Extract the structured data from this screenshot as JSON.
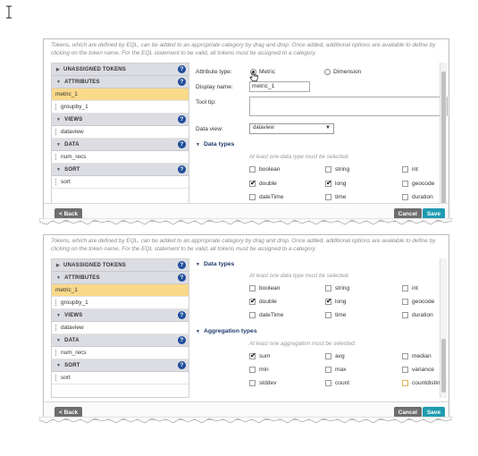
{
  "intro": "Tokens, which are defined by EQL, can be added to an appropriate category by drag and drop. Once added, additional options are available to define by clicking on the token name. For the EQL statement to be valid, all tokens must be assigned to a category.",
  "sidebar": {
    "sections": [
      {
        "title": "UNASSIGNED TOKENS",
        "items": []
      },
      {
        "title": "ATTRIBUTES",
        "items": [
          {
            "label": "metric_1",
            "selected": true
          },
          {
            "label": "groupby_1",
            "selected": false
          }
        ]
      },
      {
        "title": "VIEWS",
        "items": [
          {
            "label": "dataview",
            "selected": false
          }
        ]
      },
      {
        "title": "DATA",
        "items": [
          {
            "label": "num_recs",
            "selected": false
          }
        ]
      },
      {
        "title": "SORT",
        "items": [
          {
            "label": "sort",
            "selected": false
          }
        ]
      }
    ]
  },
  "form": {
    "attribute_type_label": "Attribute type:",
    "metric_label": "Metric",
    "dimension_label": "Dimension",
    "display_name_label": "Display name:",
    "display_name_value": "metric_1",
    "tooltip_label": "Tool tip:",
    "tooltip_value": "",
    "data_view_label": "Data view:",
    "data_view_value": "dataview"
  },
  "data_types": {
    "title": "Data types",
    "hint": "At least one data type must be selected.",
    "options": [
      {
        "label": "boolean",
        "checked": false
      },
      {
        "label": "string",
        "checked": false
      },
      {
        "label": "int",
        "checked": false
      },
      {
        "label": "double",
        "checked": true
      },
      {
        "label": "long",
        "checked": true
      },
      {
        "label": "geocode",
        "checked": false
      },
      {
        "label": "dateTime",
        "checked": false
      },
      {
        "label": "time",
        "checked": false
      },
      {
        "label": "duration",
        "checked": false
      }
    ]
  },
  "aggregation_types": {
    "title": "Aggregation types",
    "hint": "At least one aggregation must be selected.",
    "options": [
      {
        "label": "sum",
        "checked": true
      },
      {
        "label": "avg",
        "checked": false
      },
      {
        "label": "median",
        "checked": false
      },
      {
        "label": "min",
        "checked": false
      },
      {
        "label": "max",
        "checked": false
      },
      {
        "label": "variance",
        "checked": false
      },
      {
        "label": "stddev",
        "checked": false
      },
      {
        "label": "count",
        "checked": false
      },
      {
        "label": "countdistinct",
        "checked": false
      }
    ]
  },
  "buttons": {
    "back": "< Back",
    "cancel": "Cancel",
    "save": "Save"
  },
  "icons": {
    "cursor": "text-cursor-icon",
    "help": "help-icon",
    "collapse": "triangle-right-icon",
    "expand": "triangle-down-icon",
    "pointer": "hand-pointer-icon"
  }
}
